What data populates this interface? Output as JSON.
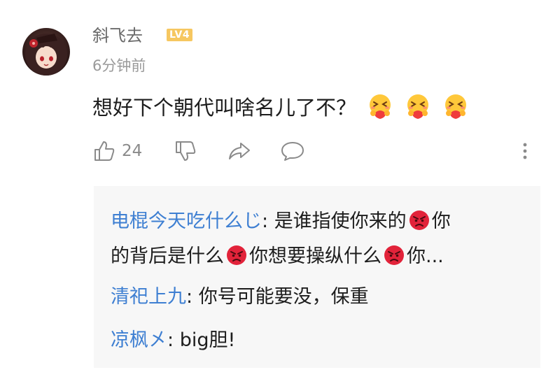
{
  "comment": {
    "username": "斜飞去",
    "level_badge": "LV4",
    "timestamp": "6分钟前",
    "text": "想好下个朝代叫啥名儿了不？",
    "emojis": [
      "hug-emoji",
      "hug-emoji",
      "hug-emoji"
    ],
    "likes": "24",
    "icons": [
      "thumbs-up-icon",
      "thumbs-down-icon",
      "share-icon",
      "comment-icon",
      "more-icon"
    ]
  },
  "replies": [
    {
      "author": "电棍今天吃什么じ",
      "sep": ": ",
      "line1_a": "是谁指使你来的",
      "line1_b": "你",
      "line2_a": "的背后是什么",
      "line2_b": "你想要操纵什么",
      "line2_c": "你..."
    },
    {
      "author": "清祀上九",
      "sep": ": ",
      "text": "你号可能要没，保重"
    },
    {
      "author": "凉枫㐅",
      "sep": ": ",
      "text": "big胆!"
    }
  ],
  "colors": {
    "author_link": "#3e7fd2",
    "level_badge": "#f6c760",
    "reply_bg": "#f7f7f7"
  }
}
